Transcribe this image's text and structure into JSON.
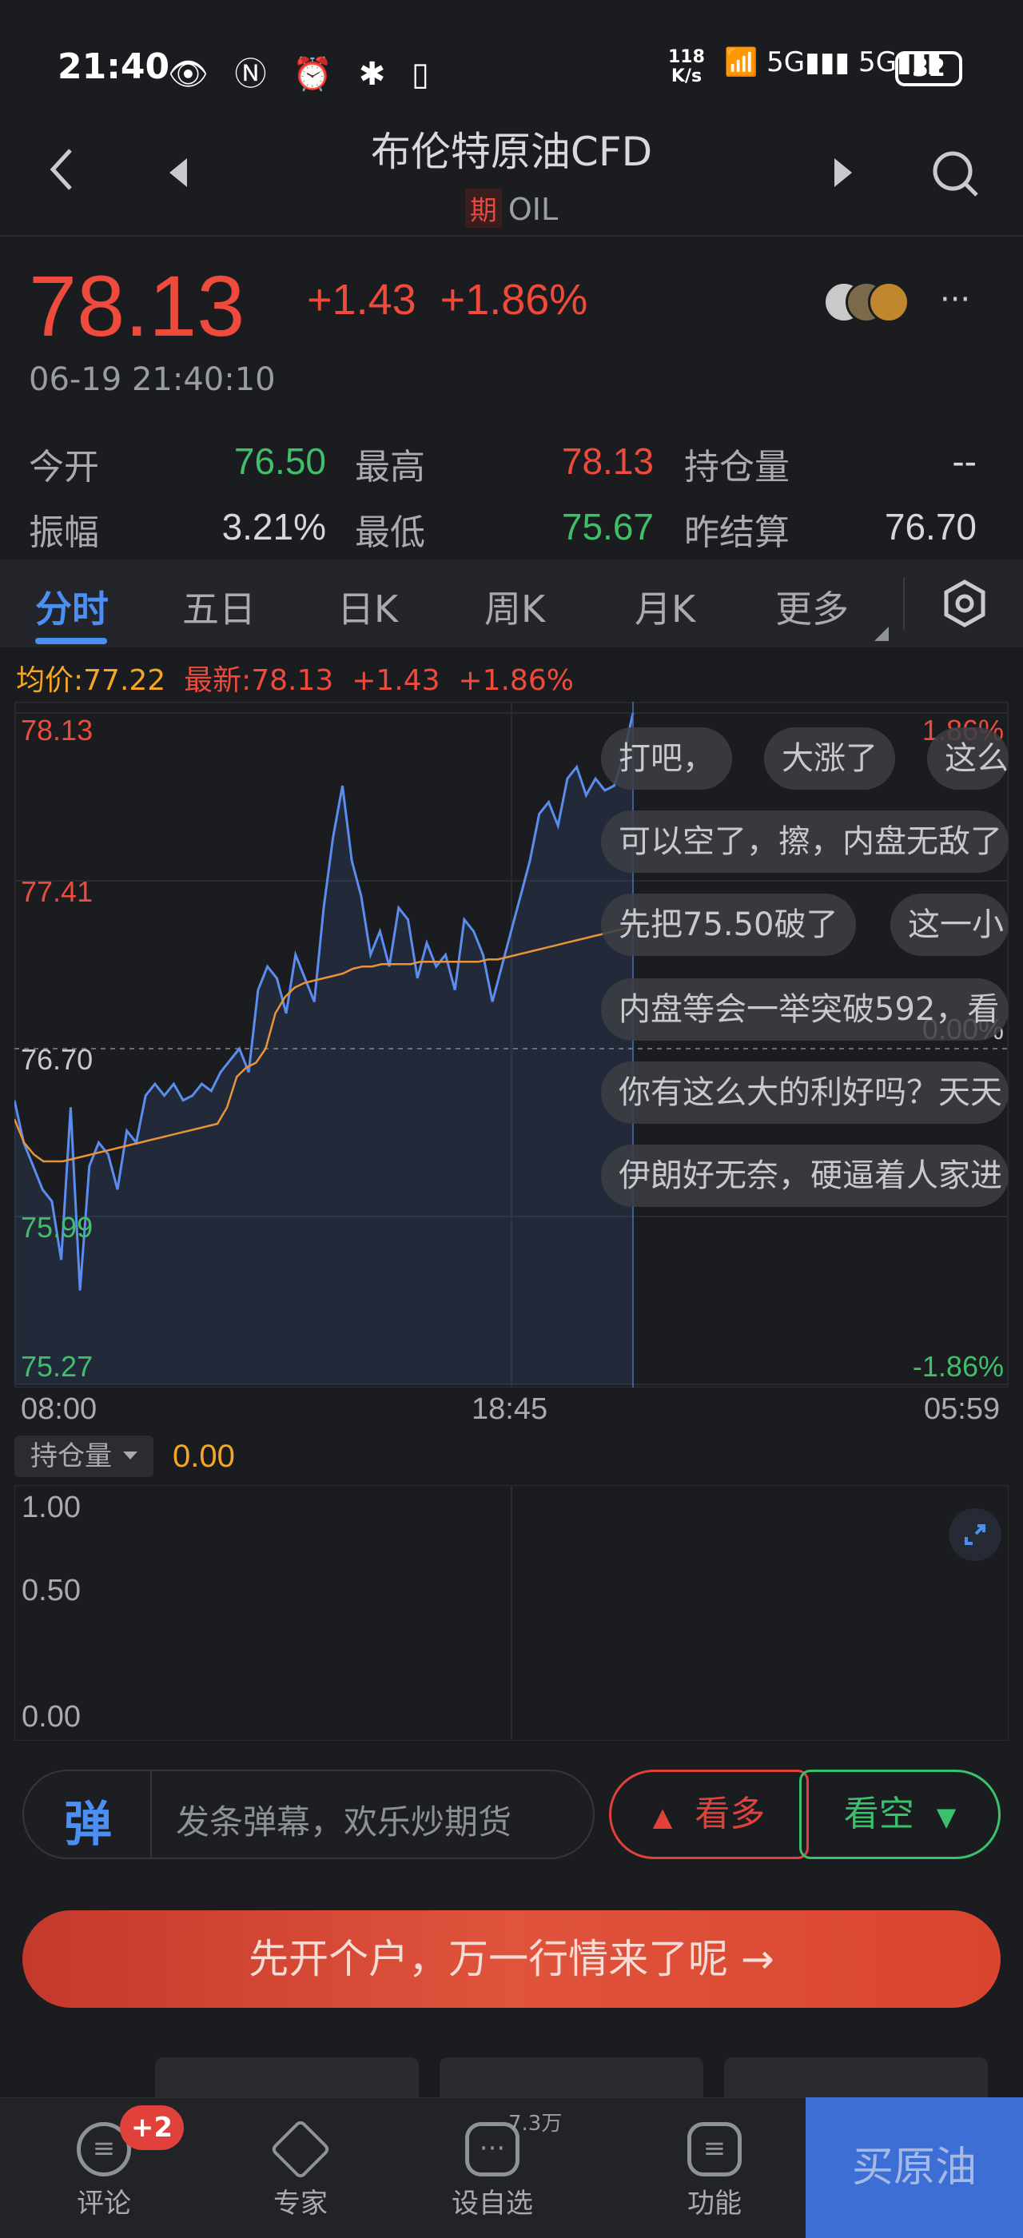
{
  "status_bar": {
    "time": "21:40",
    "icons_left": "👁 Ⓝ ⏰ ✱ ▯",
    "net_speed_top": "118",
    "net_speed_bottom": "K/s",
    "signals": "📶 5G▮▮▮ 5G▮▮▮",
    "battery": "32"
  },
  "header": {
    "title": "布伦特原油CFD",
    "tag": "期",
    "code": "OIL",
    "back_icon": "chevron-left-icon",
    "prev_icon": "triangle-left-icon",
    "next_icon": "triangle-right-icon",
    "search_icon": "search-icon"
  },
  "quote": {
    "price": "78.13",
    "change": "+1.43",
    "change_pct": "+1.86%",
    "timestamp": "06-19 21:40:10",
    "more": "···"
  },
  "stats": [
    {
      "label": "今开",
      "value": "76.50",
      "color": "#3fbf6a"
    },
    {
      "label": "最高",
      "value": "78.13",
      "color": "#ef4b3c"
    },
    {
      "label": "持仓量",
      "value": "--",
      "color": "#d6d7db"
    },
    {
      "label": "振幅",
      "value": "3.21%",
      "color": "#d6d7db"
    },
    {
      "label": "最低",
      "value": "75.67",
      "color": "#3fbf6a"
    },
    {
      "label": "昨结算",
      "value": "76.70",
      "color": "#d6d7db"
    }
  ],
  "tabs": [
    "分时",
    "五日",
    "日K",
    "周K",
    "月K",
    "更多"
  ],
  "legend": {
    "avg_label": "均价:77.22",
    "latest_label": "最新:78.13",
    "change": "+1.43",
    "change_pct": "+1.86%"
  },
  "chart_data": {
    "type": "line",
    "title": "",
    "xlabel": "",
    "ylabel": "",
    "x_ticks": [
      "08:00",
      "18:45",
      "05:59"
    ],
    "y_ticks_left": [
      "78.13",
      "77.41",
      "76.70",
      "75.99",
      "75.27"
    ],
    "y_ticks_right": [
      "1.86%",
      "0.00%",
      "-1.86%"
    ],
    "ylim": [
      75.27,
      78.13
    ],
    "reference_value": 76.7,
    "series": [
      {
        "name": "最新",
        "color": "#5b8def",
        "values": [
          76.48,
          76.3,
          76.2,
          76.1,
          76.05,
          75.8,
          76.45,
          75.67,
          76.2,
          76.3,
          76.25,
          76.1,
          76.35,
          76.3,
          76.5,
          76.55,
          76.5,
          76.55,
          76.48,
          76.5,
          76.55,
          76.52,
          76.6,
          76.65,
          76.7,
          76.6,
          76.95,
          77.05,
          77.0,
          76.85,
          77.1,
          77.0,
          76.9,
          77.3,
          77.6,
          77.82,
          77.5,
          77.35,
          77.1,
          77.2,
          77.05,
          77.3,
          77.25,
          77.0,
          77.15,
          77.05,
          77.1,
          76.95,
          77.25,
          77.2,
          77.1,
          76.9,
          77.05,
          77.2,
          77.35,
          77.5,
          77.7,
          77.75,
          77.65,
          77.85,
          77.9,
          77.78,
          77.85,
          77.8,
          77.82,
          77.95,
          78.13
        ]
      },
      {
        "name": "均价",
        "color": "#e8953a",
        "values": [
          76.4,
          76.3,
          76.25,
          76.22,
          76.22,
          76.22,
          76.23,
          76.24,
          76.25,
          76.26,
          76.27,
          76.28,
          76.29,
          76.3,
          76.31,
          76.32,
          76.33,
          76.34,
          76.35,
          76.36,
          76.37,
          76.38,
          76.45,
          76.58,
          76.62,
          76.64,
          76.7,
          76.85,
          76.92,
          76.96,
          76.98,
          76.99,
          77.0,
          77.01,
          77.02,
          77.04,
          77.05,
          77.05,
          77.06,
          77.06,
          77.06,
          77.06,
          77.07,
          77.07,
          77.07,
          77.07,
          77.07,
          77.07,
          77.07,
          77.08,
          77.08,
          77.09,
          77.1,
          77.11,
          77.12,
          77.13,
          77.14,
          77.15,
          77.16,
          77.17,
          77.18,
          77.19,
          77.2,
          77.21,
          77.22
        ]
      }
    ]
  },
  "danmaku": [
    "打吧，",
    "大涨了",
    "这么",
    "可以空了，擦，内盘无敌了",
    "先把75.50破了",
    "这一小",
    "内盘等会一举突破592，看",
    "你有这么大的利好吗？天天",
    "伊朗好无奈，硬逼着人家进"
  ],
  "open_interest": {
    "selector": "持仓量",
    "value": "0.00",
    "y_ticks": [
      "1.00",
      "0.50",
      "0.00"
    ]
  },
  "input": {
    "icon_label": "弹",
    "placeholder": "发条弹幕，欢乐炒期货"
  },
  "sentiment": {
    "bull": "看多",
    "bear": "看空"
  },
  "cta": "先开个户，万一行情来了呢 →",
  "bottom_nav": {
    "items": [
      "评论",
      "专家",
      "设自选",
      "功能"
    ],
    "badge": "+2",
    "watch_count": "7.3万",
    "buy": "买原油"
  }
}
